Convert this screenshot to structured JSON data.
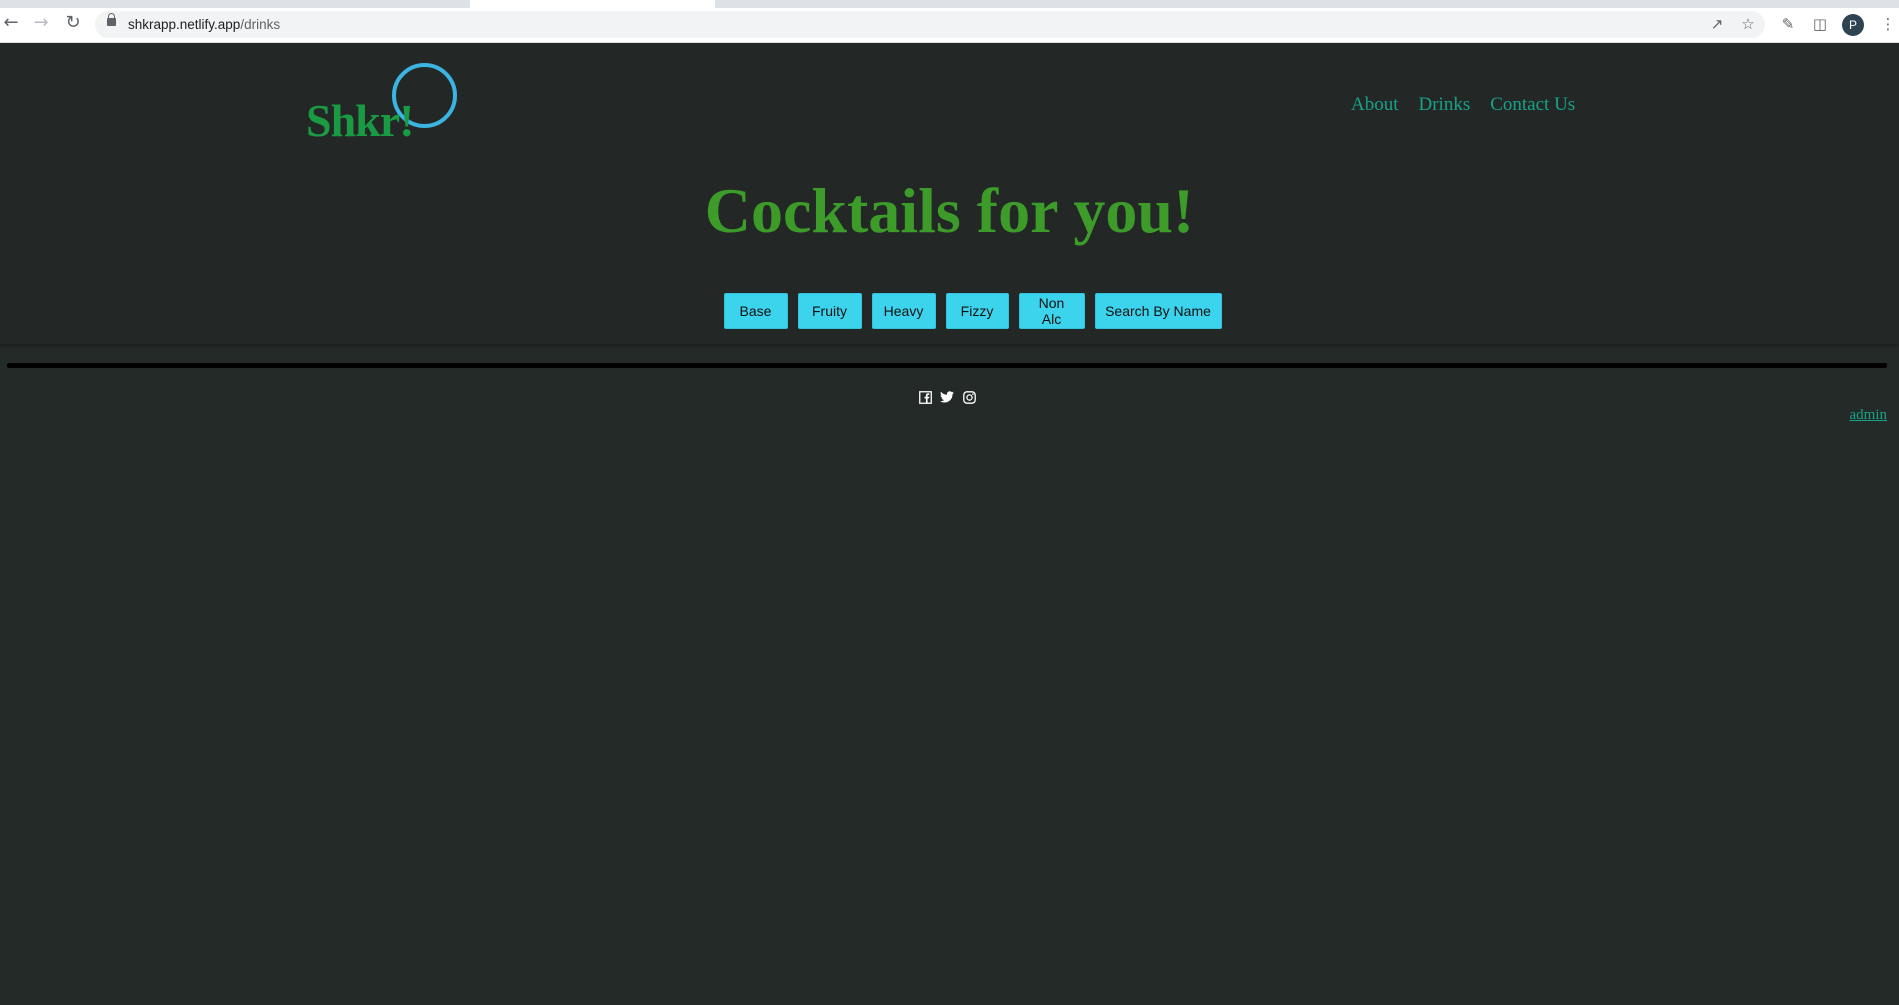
{
  "browser": {
    "url_host": "shkrapp.netlify.app",
    "url_path": "/drinks",
    "profile_initial": "P"
  },
  "site": {
    "logo": "Shkr!",
    "nav": [
      "About",
      "Drinks",
      "Contact Us"
    ],
    "hero_title": "Cocktails for you!",
    "filters": [
      "Base",
      "Fruity",
      "Heavy",
      "Fizzy",
      "Non Alc",
      "Search By Name"
    ],
    "social_icons": [
      "facebook-icon",
      "twitter-icon",
      "instagram-icon"
    ],
    "admin_link": "admin"
  },
  "colors": {
    "background": "#242a27",
    "logo": "#1b9a44",
    "logo_circle": "#3cb4e2",
    "nav_link": "#16a28a",
    "hero": "#3d9b2a",
    "filter_button": "#3cd3ec"
  }
}
